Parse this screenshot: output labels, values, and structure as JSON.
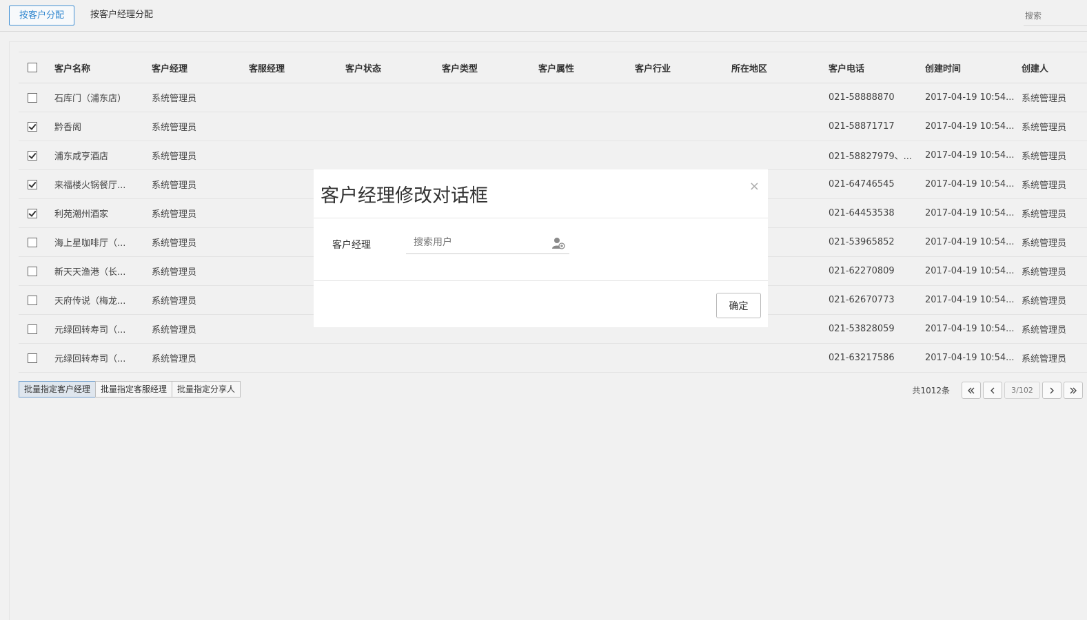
{
  "tabs": [
    "按客户分配",
    "按客户经理分配"
  ],
  "search": {
    "placeholder": "搜索"
  },
  "table": {
    "columns": [
      "客户名称",
      "客户经理",
      "客服经理",
      "客户状态",
      "客户类型",
      "客户属性",
      "客户行业",
      "所在地区",
      "客户电话",
      "创建时间",
      "创建人"
    ],
    "rows": [
      {
        "checked": false,
        "name": "石库门（浦东店）",
        "manager": "系统管理员",
        "phone": "021-58888870",
        "created": "2017-04-19 10:54...",
        "creator": "系统管理员"
      },
      {
        "checked": true,
        "name": "黔香阁",
        "manager": "系统管理员",
        "phone": "021-58871717",
        "created": "2017-04-19 10:54...",
        "creator": "系统管理员"
      },
      {
        "checked": true,
        "name": "浦东咸亨酒店",
        "manager": "系统管理员",
        "phone": "021-58827979、...",
        "created": "2017-04-19 10:54...",
        "creator": "系统管理员"
      },
      {
        "checked": true,
        "name": "来福楼火锅餐厅...",
        "manager": "系统管理员",
        "phone": "021-64746545",
        "created": "2017-04-19 10:54...",
        "creator": "系统管理员"
      },
      {
        "checked": true,
        "name": "利苑潮州酒家",
        "manager": "系统管理员",
        "phone": "021-64453538",
        "created": "2017-04-19 10:54...",
        "creator": "系统管理员"
      },
      {
        "checked": false,
        "name": "海上星咖啡厅（...",
        "manager": "系统管理员",
        "phone": "021-53965852",
        "created": "2017-04-19 10:54...",
        "creator": "系统管理员"
      },
      {
        "checked": false,
        "name": "新天天渔港（长...",
        "manager": "系统管理员",
        "phone": "021-62270809",
        "created": "2017-04-19 10:54...",
        "creator": "系统管理员"
      },
      {
        "checked": false,
        "name": "天府传说（梅龙...",
        "manager": "系统管理员",
        "phone": "021-62670773",
        "created": "2017-04-19 10:54...",
        "creator": "系统管理员"
      },
      {
        "checked": false,
        "name": "元绿回转寿司（...",
        "manager": "系统管理员",
        "phone": "021-53828059",
        "created": "2017-04-19 10:54...",
        "creator": "系统管理员"
      },
      {
        "checked": false,
        "name": "元绿回转寿司（...",
        "manager": "系统管理员",
        "phone": "021-63217586",
        "created": "2017-04-19 10:54...",
        "creator": "系统管理员"
      }
    ]
  },
  "bulk_actions": [
    "批量指定客户经理",
    "批量指定客服经理",
    "批量指定分享人"
  ],
  "pagination": {
    "total": "共1012条",
    "page": "3/102",
    "first_icon": "double-chevron-left-icon",
    "prev_icon": "chevron-left-icon",
    "next_icon": "chevron-right-icon",
    "last_icon": "double-chevron-right-icon"
  },
  "dialog": {
    "title": "客户经理修改对话框",
    "close": "×",
    "field_label": "客户经理",
    "field_placeholder": "搜索用户",
    "field_icon": "user-add-icon",
    "confirm": "确定"
  }
}
